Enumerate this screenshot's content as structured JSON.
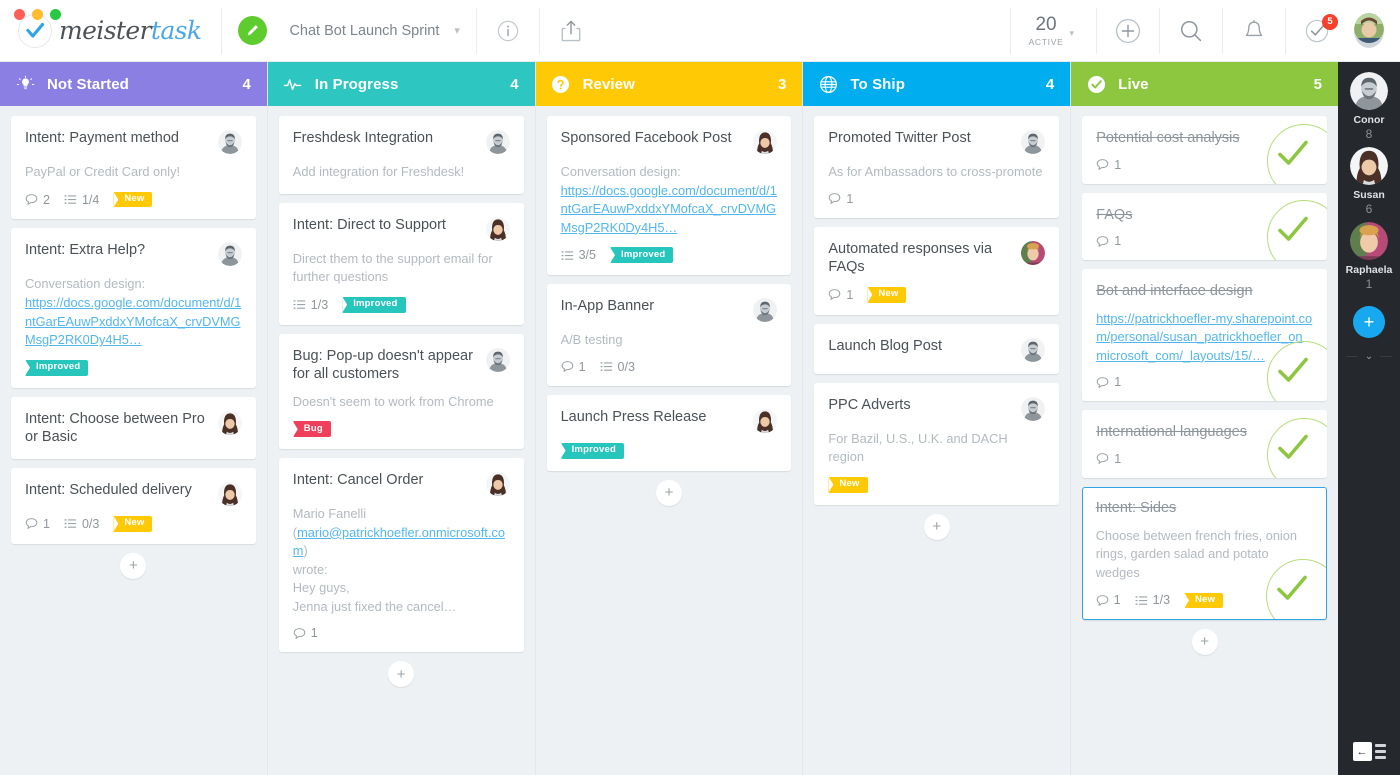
{
  "app": {
    "brand_first": "meister",
    "brand_second": "task",
    "project_name": "Chat Bot Launch Sprint",
    "project_caret": "▾",
    "active_number": "20",
    "active_label": "ACTIVE",
    "active_caret": "▾",
    "notifications_badge": "5",
    "colors": {
      "not_started": "#8b7fe3",
      "in_progress": "#2ec6c0",
      "review": "#ffc905",
      "to_ship": "#00aeef",
      "live": "#8dc63f",
      "accent_blue": "#18a8f0",
      "tag_new": "#ffc905",
      "tag_improved": "#27c6bd",
      "tag_bug": "#ef3f5b",
      "link": "#53b7ef",
      "board_bg": "#eef1f4",
      "rail_bg": "#25282c"
    },
    "header_icons": [
      "info-icon",
      "share-icon",
      "plus-icon",
      "search-icon",
      "bell-icon",
      "checklist-icon"
    ],
    "add_card_label": "+"
  },
  "columns": [
    {
      "name": "Not Started",
      "count": "4",
      "color": "#8b7fe3",
      "icon": "lightbulb-icon",
      "cards": [
        {
          "title": "Intent: Payment method",
          "desc_lines": [
            "PayPal or Credit Card only!"
          ],
          "avatar": "male-1",
          "comments": "2",
          "checklist": "1/4",
          "tags": [
            {
              "label": "New",
              "type": "new"
            }
          ],
          "done": false,
          "selected": false
        },
        {
          "title": "Intent: Extra Help?",
          "desc_lines": [
            "Conversation design:"
          ],
          "link": "https://docs.google.com/document/d/1ntGarEAuwPxddxYMofcaX_crvDVMGMsgP2RK0Dy4H5…",
          "avatar": "male-1",
          "tags": [
            {
              "label": "Improved",
              "type": "improved"
            }
          ],
          "done": false,
          "selected": false
        },
        {
          "title": "Intent: Choose between Pro or Basic",
          "avatar": "female-1",
          "done": false,
          "selected": false
        },
        {
          "title": "Intent: Scheduled delivery",
          "avatar": "female-1",
          "comments": "1",
          "checklist": "0/3",
          "tags": [
            {
              "label": "New",
              "type": "new"
            }
          ],
          "done": false,
          "selected": false
        }
      ]
    },
    {
      "name": "In Progress",
      "count": "4",
      "color": "#2ec6c0",
      "icon": "pulse-icon",
      "cards": [
        {
          "title": "Freshdesk Integration",
          "desc_lines": [
            "Add integration for Freshdesk!"
          ],
          "avatar": "male-1",
          "done": false,
          "selected": false
        },
        {
          "title": "Intent: Direct to Support",
          "desc_lines": [
            "Direct them to the support email for further questions"
          ],
          "avatar": "female-1",
          "checklist": "1/3",
          "tags": [
            {
              "label": "Improved",
              "type": "improved"
            }
          ],
          "done": false,
          "selected": false
        },
        {
          "title": "Bug: Pop-up doesn't appear for all customers",
          "desc_lines": [
            "Doesn't seem to work from Chrome"
          ],
          "avatar": "male-1",
          "tags": [
            {
              "label": "Bug",
              "type": "bug"
            }
          ],
          "done": false,
          "selected": false
        },
        {
          "title": "Intent: Cancel Order",
          "desc_lines": [
            "Mario Fanelli",
            "wrote:",
            "Hey guys,",
            "Jenna just fixed the cancel…"
          ],
          "email_link": "mario@patrickhoefler.onmicrosoft.com",
          "avatar": "female-1",
          "comments": "1",
          "done": false,
          "selected": false
        }
      ]
    },
    {
      "name": "Review",
      "count": "3",
      "color": "#ffc905",
      "icon": "question-icon",
      "cards": [
        {
          "title": "Sponsored Facebook Post",
          "desc_lines": [
            "Conversation design:"
          ],
          "link": "https://docs.google.com/document/d/1ntGarEAuwPxddxYMofcaX_crvDVMGMsgP2RK0Dy4H5…",
          "avatar": "female-1",
          "checklist": "3/5",
          "tags": [
            {
              "label": "Improved",
              "type": "improved"
            }
          ],
          "done": false,
          "selected": false
        },
        {
          "title": "In-App Banner",
          "desc_lines": [
            "A/B testing"
          ],
          "avatar": "male-1",
          "comments": "1",
          "checklist": "0/3",
          "done": false,
          "selected": false
        },
        {
          "title": "Launch Press Release",
          "avatar": "female-1",
          "tags": [
            {
              "label": "Improved",
              "type": "improved"
            }
          ],
          "done": false,
          "selected": false
        }
      ]
    },
    {
      "name": "To Ship",
      "count": "4",
      "color": "#00aeef",
      "icon": "globe-icon",
      "cards": [
        {
          "title": "Promoted Twitter Post",
          "desc_lines": [
            "As for Ambassadors to cross-promote"
          ],
          "avatar": "male-1",
          "comments": "1",
          "done": false,
          "selected": false
        },
        {
          "title": "Automated responses via FAQs",
          "avatar": "female-2",
          "comments": "1",
          "tags": [
            {
              "label": "New",
              "type": "new"
            }
          ],
          "done": false,
          "selected": false
        },
        {
          "title": "Launch Blog Post",
          "avatar": "male-1",
          "done": false,
          "selected": false
        },
        {
          "title": "PPC Adverts",
          "desc_lines": [
            "For Bazil, U.S., U.K. and DACH region"
          ],
          "avatar": "male-1",
          "tags": [
            {
              "label": "New",
              "type": "new"
            }
          ],
          "done": false,
          "selected": false
        }
      ]
    },
    {
      "name": "Live",
      "count": "5",
      "color": "#8dc63f",
      "icon": "check-circle-icon",
      "cards": [
        {
          "title": "Potential cost analysis",
          "comments": "1",
          "done": true,
          "selected": false
        },
        {
          "title": "FAQs",
          "comments": "1",
          "done": true,
          "selected": false
        },
        {
          "title": "Bot and interface design",
          "link": "https://patrickhoefler-my.sharepoint.com/personal/susan_patrickhoefler_onmicrosoft_com/_layouts/15/…",
          "comments": "1",
          "done": true,
          "selected": false
        },
        {
          "title": "International languages",
          "comments": "1",
          "done": true,
          "selected": false
        },
        {
          "title": "Intent: Sides",
          "desc_lines": [
            "Choose between french fries, onion rings, garden salad and potato wedges"
          ],
          "comments": "1",
          "checklist": "1/3",
          "tags": [
            {
              "label": "New",
              "type": "new"
            }
          ],
          "done": true,
          "selected": true
        }
      ]
    }
  ],
  "rail": {
    "users": [
      {
        "name": "Conor",
        "count": "8",
        "avatar": "male-1"
      },
      {
        "name": "Susan",
        "count": "6",
        "avatar": "female-1"
      },
      {
        "name": "Raphaela",
        "count": "1",
        "avatar": "female-2"
      }
    ],
    "add_label": "+",
    "chevron": "⌄",
    "collapse_icon": "collapse-sidebar-icon"
  }
}
